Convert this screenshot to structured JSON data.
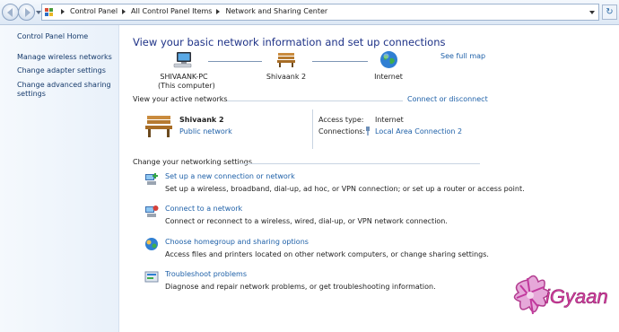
{
  "address_bar": {
    "crumbs": [
      "Control Panel",
      "All Control Panel Items",
      "Network and Sharing Center"
    ],
    "refresh_symbol": "↻"
  },
  "left_nav": {
    "home": "Control Panel Home",
    "items": [
      "Manage wireless networks",
      "Change adapter settings",
      "Change advanced sharing",
      "settings"
    ]
  },
  "main": {
    "title": "View your basic network information and set up connections",
    "see_full_map": "See full map",
    "map": {
      "computer_name": "SHIVAANK-PC",
      "computer_sub": "(This computer)",
      "network_name": "Shivaank  2",
      "internet": "Internet"
    },
    "active_networks": {
      "heading": "View your active networks",
      "connect_link": "Connect or disconnect",
      "network_name": "Shivaank  2",
      "network_type": "Public network",
      "access_type_label": "Access type:",
      "access_type_value": "Internet",
      "connections_label": "Connections:",
      "connections_value": "Local Area Connection 2"
    },
    "settings": {
      "heading": "Change your networking settings",
      "tasks": [
        {
          "title": "Set up a new connection or network",
          "desc": "Set up a wireless, broadband, dial-up, ad hoc, or VPN connection; or set up a router or access point."
        },
        {
          "title": "Connect to a network",
          "desc": "Connect or reconnect to a wireless, wired, dial-up, or VPN network connection."
        },
        {
          "title": "Choose homegroup and sharing options",
          "desc": "Access files and printers located on other network computers, or change sharing settings."
        },
        {
          "title": "Troubleshoot problems",
          "desc": "Diagnose and repair network problems, or get troubleshooting information."
        }
      ]
    }
  },
  "watermark": {
    "text": "iGyaan"
  },
  "colors": {
    "title": "#1e3287",
    "link": "#1e60a8",
    "nav_link": "#153a6b",
    "left_pane": "#eef4fb",
    "watermark": "#d6409f"
  },
  "icons": {
    "computer": "computer-icon",
    "bench": "bench-icon",
    "globe": "globe-icon"
  }
}
